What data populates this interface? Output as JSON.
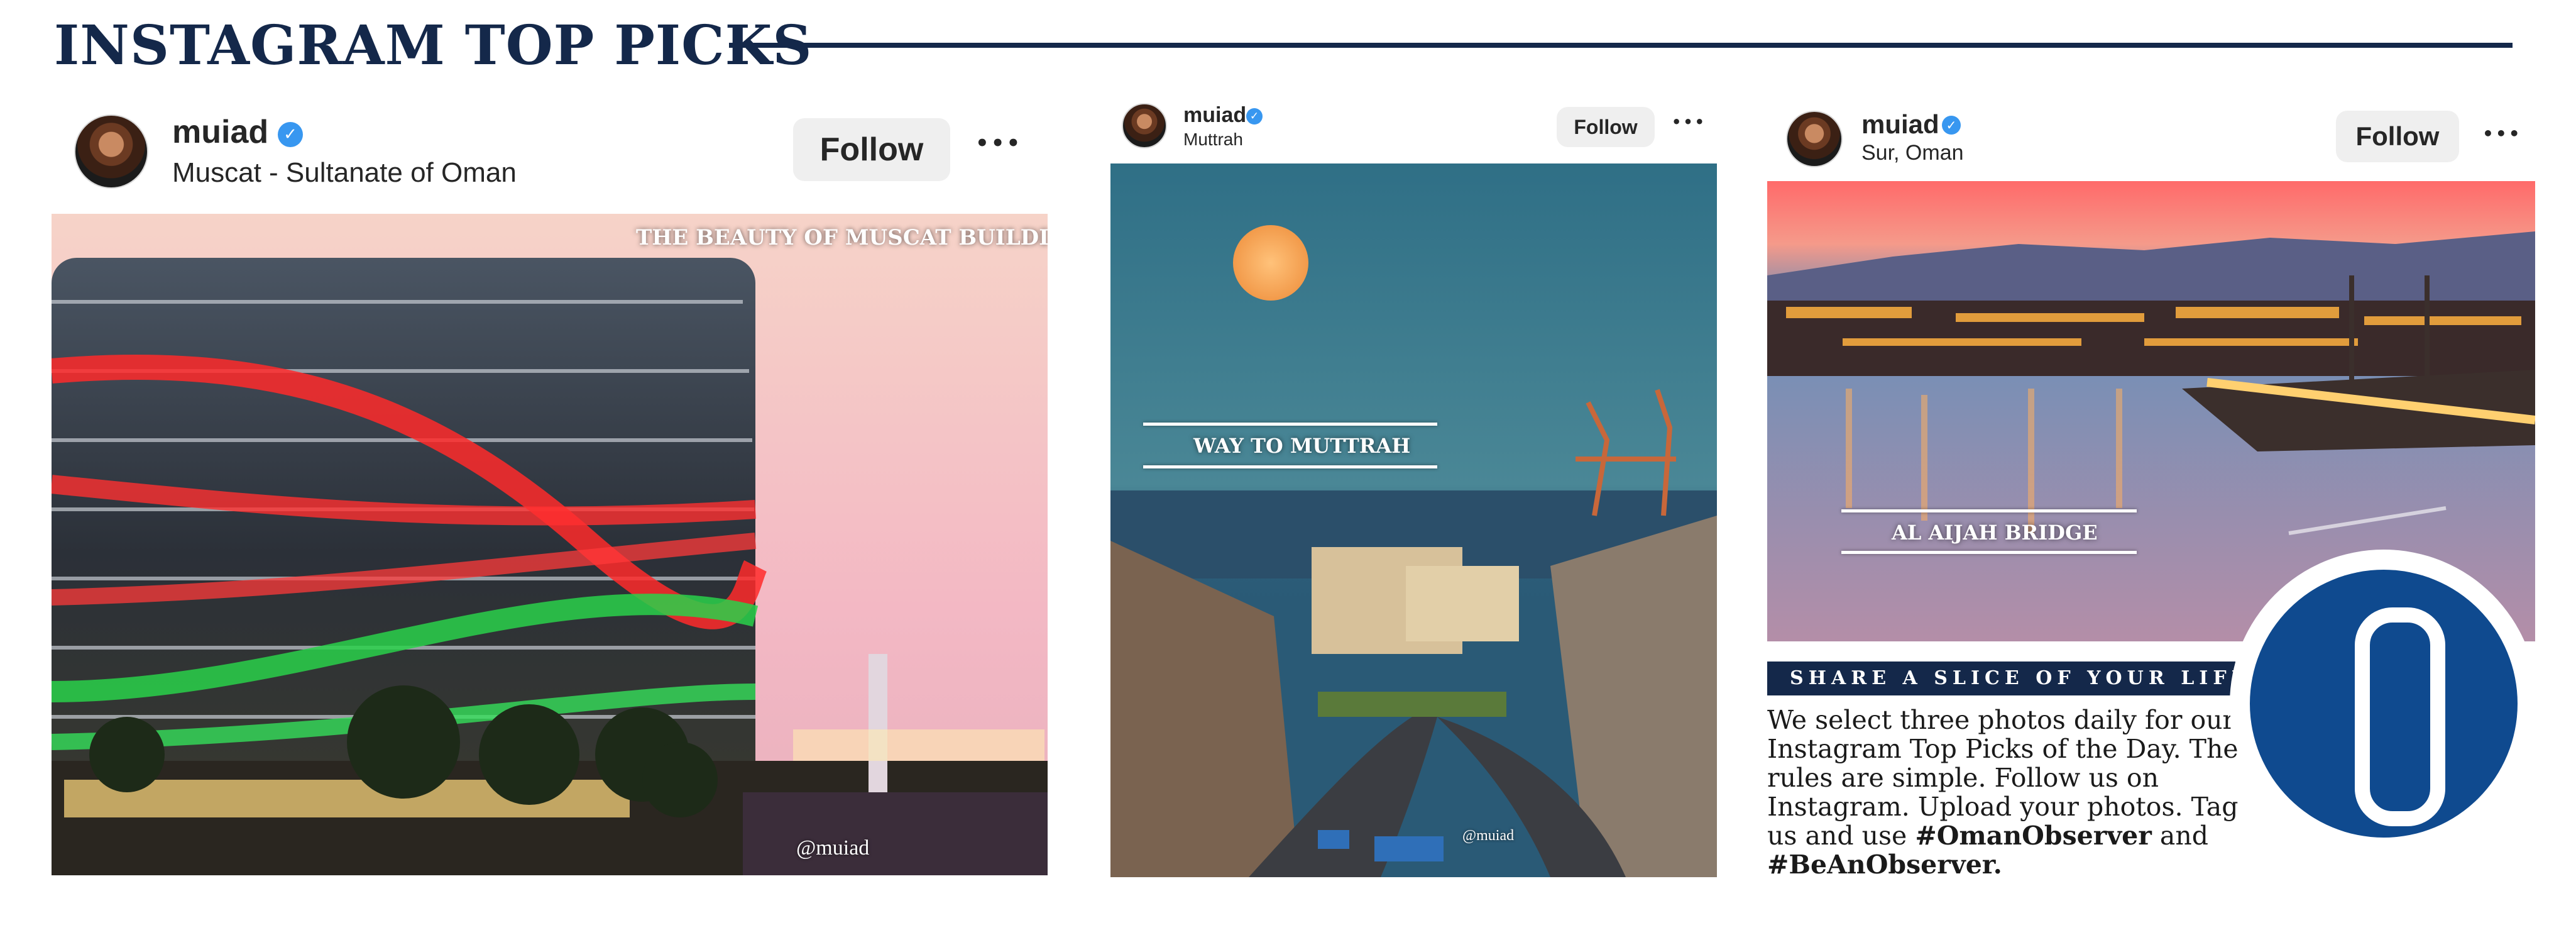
{
  "header": {
    "title": "INSTAGRAM TOP PICKS"
  },
  "posts": [
    {
      "username": "muiad",
      "verified_icon": "verified-badge-icon",
      "location": "Muscat - Sultanate of Oman",
      "follow_label": "Follow",
      "more_label": "•••",
      "caption": "THE BEAUTY OF  MUSCAT BUILDINGS",
      "watermark": "@muiad"
    },
    {
      "username": "muiad",
      "verified_icon": "verified-badge-icon",
      "location": "Muttrah",
      "follow_label": "Follow",
      "more_label": "•••",
      "caption": "WAY TO MUTTRAH",
      "watermark": "@muiad"
    },
    {
      "username": "muiad",
      "verified_icon": "verified-badge-icon",
      "location": "Sur, Oman",
      "follow_label": "Follow",
      "more_label": "•••",
      "caption": "AL AIJAH BRIDGE",
      "watermark": ""
    }
  ],
  "share": {
    "heading": "SHARE A SLICE OF YOUR LIFE",
    "text_1": "We select three photos daily for our Instagram Top Picks of the Day. The rules are simple. Follow us on Instagram. Upload your photos. Tag us and use ",
    "hashtag_1": "#OmanObserver",
    "text_2": " and ",
    "hashtag_2": "#BeAnObserver.",
    "logo_icon": "oman-observer-logo-icon"
  },
  "colors": {
    "brand_navy": "#14284a",
    "logo_blue": "#0f4a8f",
    "verified_blue": "#3897f0"
  }
}
